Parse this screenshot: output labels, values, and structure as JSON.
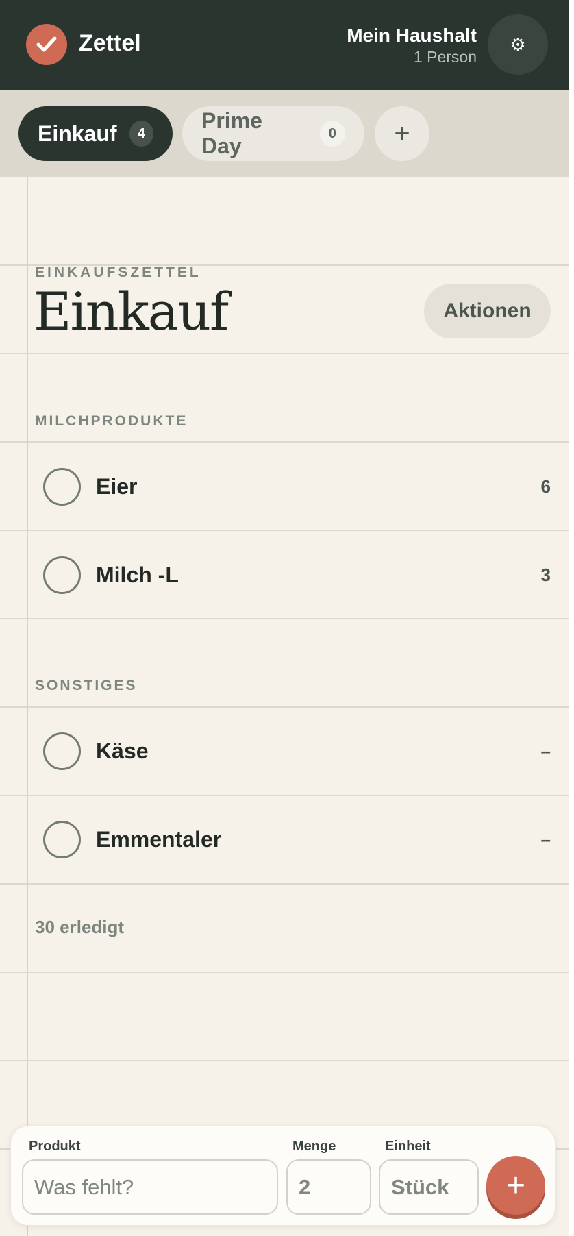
{
  "header": {
    "app_title": "Zettel",
    "household_name": "Mein Haushalt",
    "household_members": "1 Person",
    "settings_icon": "gear-icon",
    "brand_color": "#cf6a55",
    "header_bg": "#2b3530"
  },
  "tabs": [
    {
      "label": "Einkauf",
      "count": "4",
      "active": true
    },
    {
      "label": "Prime Day",
      "count": "0",
      "active": false
    }
  ],
  "add_tab_label": "+",
  "list": {
    "eyebrow": "EINKAUFSZETTEL",
    "title": "Einkauf",
    "actions_label": "Aktionen"
  },
  "categories": [
    {
      "name": "MILCHPRODUKTE",
      "items": [
        {
          "name": "Eier",
          "qty": "6"
        },
        {
          "name": "Milch -L",
          "qty": "3"
        }
      ]
    },
    {
      "name": "SONSTIGES",
      "items": [
        {
          "name": "Käse",
          "qty": "–"
        },
        {
          "name": "Emmentaler",
          "qty": "–"
        }
      ]
    }
  ],
  "done_count": "30 erledigt",
  "form": {
    "product_label": "Produkt",
    "product_placeholder": "Was fehlt?",
    "qty_label": "Menge",
    "qty_value": "2",
    "unit_label": "Einheit",
    "unit_value": "Stück",
    "submit_label": "+"
  }
}
